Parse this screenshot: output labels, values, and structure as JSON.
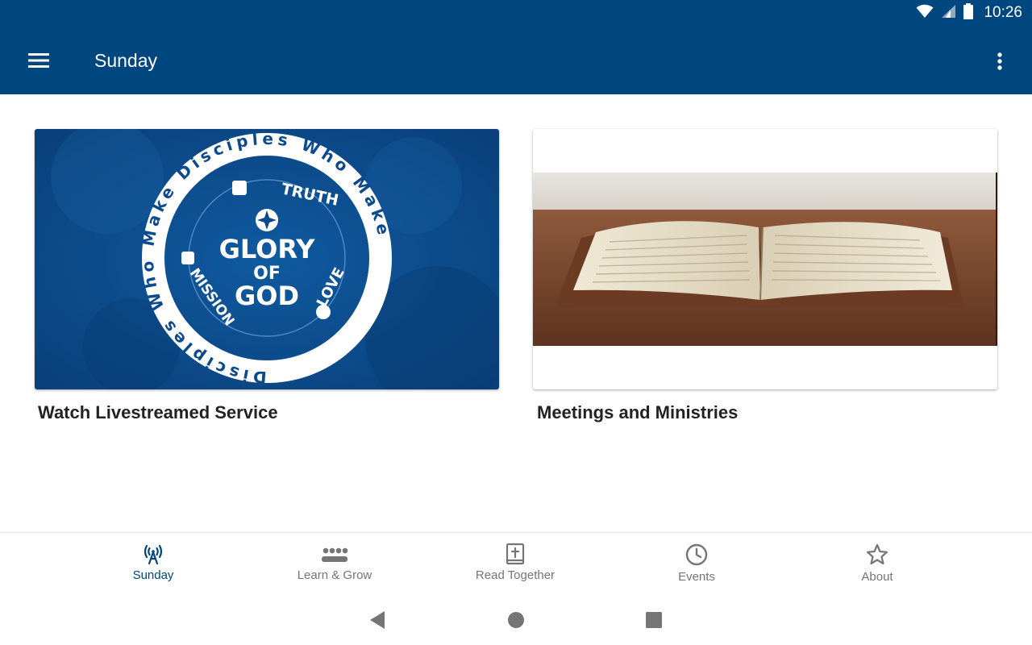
{
  "status": {
    "time": "10:26"
  },
  "appbar": {
    "title": "Sunday"
  },
  "cards": [
    {
      "label": "Watch Livestreamed Service",
      "logo": {
        "ring_text": "Disciples Who Make Disciples Who Make",
        "center_line1": "GLORY",
        "center_line2": "OF",
        "center_line3": "GOD",
        "word_top": "TRUTH",
        "word_left": "MISSION",
        "word_right": "LOVE"
      }
    },
    {
      "label": "Meetings and Ministries"
    }
  ],
  "bottom_nav": [
    {
      "label": "Sunday",
      "icon": "broadcast-icon",
      "active": true
    },
    {
      "label": "Learn & Grow",
      "icon": "groups-icon",
      "active": false
    },
    {
      "label": "Read Together",
      "icon": "bible-icon",
      "active": false
    },
    {
      "label": "Events",
      "icon": "clock-icon",
      "active": false
    },
    {
      "label": "About",
      "icon": "star-icon",
      "active": false
    }
  ],
  "colors": {
    "primary": "#00467f",
    "inactive": "#757575"
  }
}
